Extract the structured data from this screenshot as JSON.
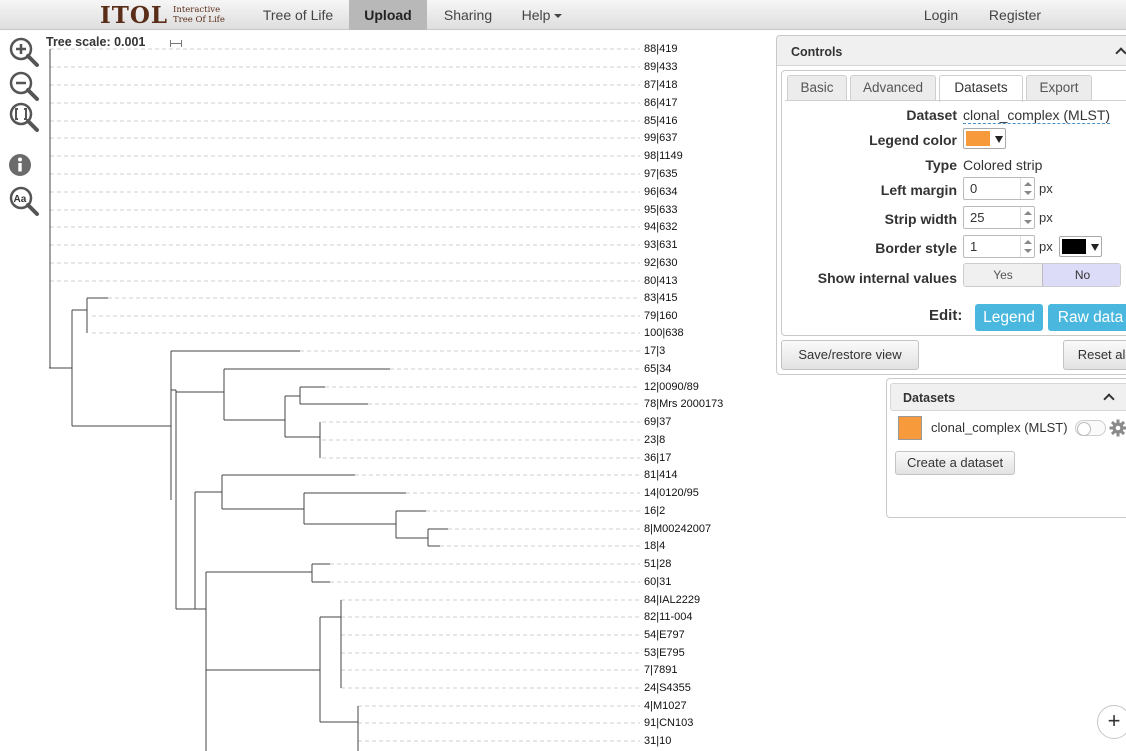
{
  "navbar": {
    "logo_main": "ITOL",
    "logo_line1": "Interactive",
    "logo_line2": "Tree Of Life",
    "items": [
      {
        "label": "Tree of Life"
      },
      {
        "label": "Upload"
      },
      {
        "label": "Sharing"
      },
      {
        "label": "Help"
      },
      {
        "label": "Login"
      },
      {
        "label": "Register"
      }
    ]
  },
  "toolbar": {
    "tools": [
      "zoom-in-icon",
      "zoom-out-icon",
      "fit-view-icon",
      "info-icon",
      "font-size-icon"
    ]
  },
  "tree": {
    "scale_label": "Tree scale: 0.001",
    "leaves": [
      "88|419",
      "89|433",
      "87|418",
      "86|417",
      "85|416",
      "99|637",
      "98|1149",
      "97|635",
      "96|634",
      "95|633",
      "94|632",
      "93|631",
      "92|630",
      "80|413",
      "83|415",
      "79|160",
      "100|638",
      "17|3",
      "65|34",
      "12|0090/89",
      "78|Mrs 2000173",
      "69|37",
      "23|8",
      "36|17",
      "81|414",
      "14|0120/95",
      "16|2",
      "8|M00242007",
      "18|4",
      "51|28",
      "60|31",
      "84|IAL2229",
      "82|11-004",
      "54|E797",
      "53|E795",
      "7|7891",
      "24|S4355",
      "4|M1027",
      "91|CN103",
      "31|10"
    ]
  },
  "controls": {
    "title": "Controls",
    "tabs": [
      "Basic",
      "Advanced",
      "Datasets",
      "Export"
    ],
    "active_tab": "Datasets",
    "fields": {
      "dataset_label": "Dataset",
      "dataset_value": "clonal_complex (MLST)",
      "legend_color_label": "Legend color",
      "legend_color": "#f79a3b",
      "type_label": "Type",
      "type_value": "Colored strip",
      "left_margin_label": "Left margin",
      "left_margin": "0",
      "strip_width_label": "Strip width",
      "strip_width": "25",
      "border_style_label": "Border style",
      "border_style": "1",
      "border_color": "#000000",
      "unit": "px",
      "show_internal_label": "Show internal values",
      "yes": "Yes",
      "no": "No"
    },
    "edit_label": "Edit:",
    "legend_button": "Legend",
    "raw_data_button": "Raw data",
    "save_restore_button": "Save/restore view",
    "reset_button": "Reset all"
  },
  "datasets_panel": {
    "title": "Datasets",
    "items": [
      {
        "name": "clonal_complex (MLST)",
        "color": "#f79a3b"
      }
    ],
    "create_button": "Create a dataset"
  },
  "colors": {
    "accent_blue": "#4ab8de",
    "orange": "#f79a3b"
  }
}
